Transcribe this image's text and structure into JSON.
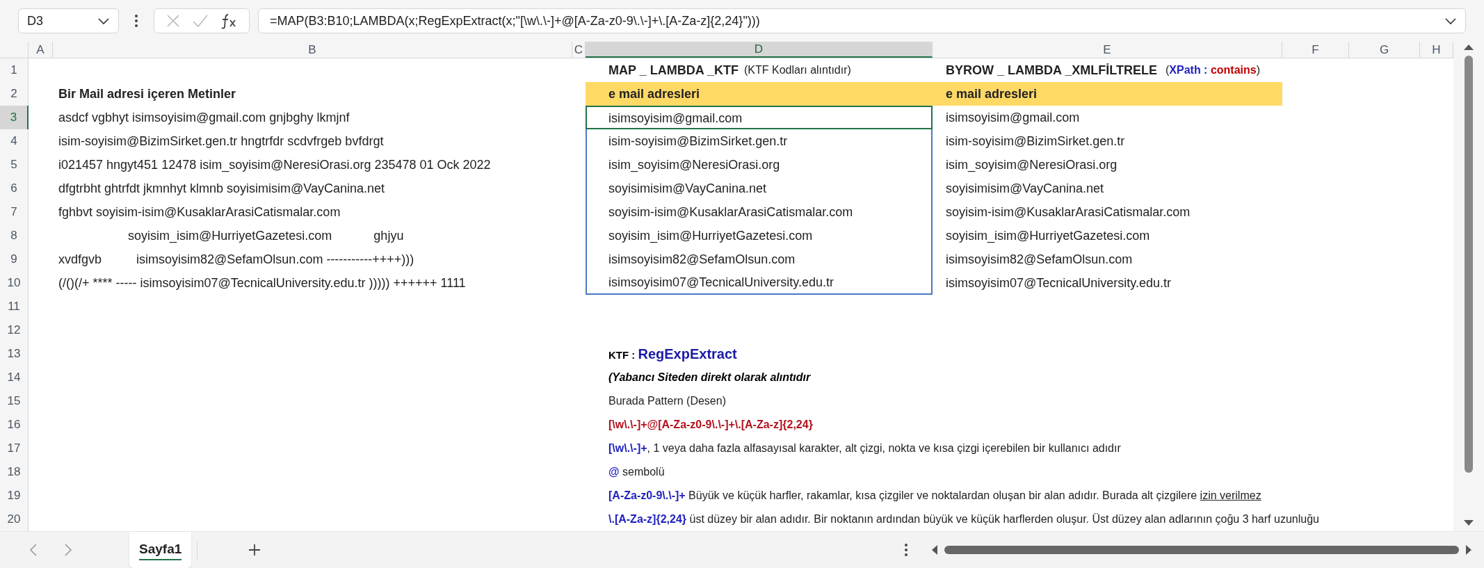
{
  "formula_bar": {
    "name_box": "D3",
    "formula": "=MAP(B3:B10;LAMBDA(x;RegExpExtract(x;\"[\\w\\.\\-]+@[A-Za-z0-9\\.\\-]+\\.[A-Za-z]{2,24}\")))"
  },
  "column_headers": [
    {
      "label": "A",
      "selected": false
    },
    {
      "label": "B",
      "selected": false
    },
    {
      "label": "C",
      "selected": false
    },
    {
      "label": "D",
      "selected": true
    },
    {
      "label": "E",
      "selected": false
    },
    {
      "label": "F",
      "selected": false
    },
    {
      "label": "G",
      "selected": false
    },
    {
      "label": "H",
      "selected": false
    }
  ],
  "row_headers": [
    {
      "label": "1",
      "selected": false
    },
    {
      "label": "2",
      "selected": false
    },
    {
      "label": "3",
      "selected": true
    },
    {
      "label": "4",
      "selected": false
    },
    {
      "label": "5",
      "selected": false
    },
    {
      "label": "6",
      "selected": false
    },
    {
      "label": "7",
      "selected": false
    },
    {
      "label": "8",
      "selected": false
    },
    {
      "label": "9",
      "selected": false
    },
    {
      "label": "10",
      "selected": false
    },
    {
      "label": "11",
      "selected": false
    },
    {
      "label": "12",
      "selected": false
    },
    {
      "label": "13",
      "selected": false
    },
    {
      "label": "14",
      "selected": false
    },
    {
      "label": "15",
      "selected": false
    },
    {
      "label": "16",
      "selected": false
    },
    {
      "label": "17",
      "selected": false
    },
    {
      "label": "18",
      "selected": false
    },
    {
      "label": "19",
      "selected": false
    },
    {
      "label": "20",
      "selected": false
    }
  ],
  "sheet": {
    "b": {
      "header": "Bir Mail adresi içeren Metinler",
      "texts": [
        "asdcf vgbhyt isimsoyisim@gmail.com gnjbghy lkmjnf",
        "isim-soyisim@BizimSirket.gen.tr hngtrfdr scdvfrgeb bvfdrgt",
        "i021457 hngyt451 12478 isim_soyisim@NeresiOrasi.org 235478 01 Ock 2022",
        "dfgtrbht ghtrfdt jkmnhyt klmnb soyisimisim@VayCanina.net",
        "fghbvt soyisim-isim@KusaklarArasiCatismalar.com",
        "                    soyisim_isim@HurriyetGazetesi.com            ghjyu",
        "xvdfgvb          isimsoyisim82@SefamOlsun.com -----------++++)))",
        "(/()(/+ **** ----- isimsoyisim07@TecnicalUniversity.edu.tr ))))) ++++++ 1111"
      ]
    },
    "d": {
      "title": "MAP _ LAMBDA _KTF",
      "note": "(KTF Kodları alıntıdır)",
      "header": "e mail adresleri",
      "values": [
        {
          "text": "isimsoyisim@gmail.com",
          "selected": true
        },
        {
          "text": "isim-soyisim@BizimSirket.gen.tr",
          "selected": false
        },
        {
          "text": "isim_soyisim@NeresiOrasi.org",
          "selected": false
        },
        {
          "text": "soyisimisim@VayCanina.net",
          "selected": false
        },
        {
          "text": "soyisim-isim@KusaklarArasiCatismalar.com",
          "selected": false
        },
        {
          "text": "soyisim_isim@HurriyetGazetesi.com",
          "selected": false
        },
        {
          "text": "isimsoyisim82@SefamOlsun.com",
          "selected": false
        },
        {
          "text": "isimsoyisim07@TecnicalUniversity.edu.tr",
          "selected": false
        }
      ]
    },
    "e": {
      "title": "BYROW _ LAMBDA _XMLFİLTRELE",
      "note": [
        {
          "text": "(",
          "kind": "plain"
        },
        {
          "text": "XPath : ",
          "kind": "keyword"
        },
        {
          "text": "contains",
          "kind": "value"
        },
        {
          "text": ")",
          "kind": "plain"
        }
      ],
      "header": "e mail adresleri",
      "values": [
        "isimsoyisim@gmail.com",
        "isim-soyisim@BizimSirket.gen.tr",
        "isim_soyisim@NeresiOrasi.org",
        "soyisimisim@VayCanina.net",
        "soyisim-isim@KusaklarArasiCatismalar.com",
        "soyisim_isim@HurriyetGazetesi.com",
        "isimsoyisim82@SefamOlsun.com",
        "isimsoyisim07@TecnicalUniversity.edu.tr"
      ]
    }
  },
  "notes": [
    {
      "parts": [
        {
          "text": "KTF : ",
          "kind": "label"
        },
        {
          "text": "RegExpExtract",
          "kind": "function"
        }
      ]
    },
    {
      "parts": [
        {
          "text": "(Yabancı Siteden direkt olarak alıntıdır",
          "kind": "italic"
        }
      ]
    },
    {
      "parts": [
        {
          "text": "Burada Pattern (Desen)",
          "kind": "plain"
        }
      ]
    },
    {
      "parts": [
        {
          "text": "[\\w\\.\\-]+@[A-Za-z0-9\\.\\-]+\\.[A-Za-z]{2,24}",
          "kind": "pattern"
        }
      ]
    },
    {
      "parts": [
        {
          "text": "[\\w\\.\\-]+",
          "kind": "code"
        },
        {
          "text": ", 1 veya daha fazla alfasayısal karakter, alt çizgi, nokta ve kısa çizgi içerebilen bir kullanıcı adıdır",
          "kind": "plain"
        }
      ]
    },
    {
      "parts": [
        {
          "text": "@",
          "kind": "code"
        },
        {
          "text": " sembolü",
          "kind": "plain"
        }
      ]
    },
    {
      "parts": [
        {
          "text": "[A-Za-z0-9\\.\\-]+",
          "kind": "code"
        },
        {
          "text": " Büyük ve küçük harfler, rakamlar, kısa çizgiler ve noktalardan oluşan bir alan adıdır. Burada alt çizgilere ",
          "kind": "plain"
        },
        {
          "text": "izin verilmez",
          "kind": "underlined"
        }
      ]
    },
    {
      "parts": [
        {
          "text": "\\.[A-Za-z]{2,24}",
          "kind": "code"
        },
        {
          "text": " üst düzey bir alan adıdır. Bir noktanın ardından büyük ve küçük harflerden oluşur. Üst düzey alan adlarının çoğu 3 harf uzunluğu",
          "kind": "plain"
        }
      ]
    }
  ],
  "sheet_tabs": [
    {
      "label": "Sayfa1",
      "selected": true
    }
  ]
}
